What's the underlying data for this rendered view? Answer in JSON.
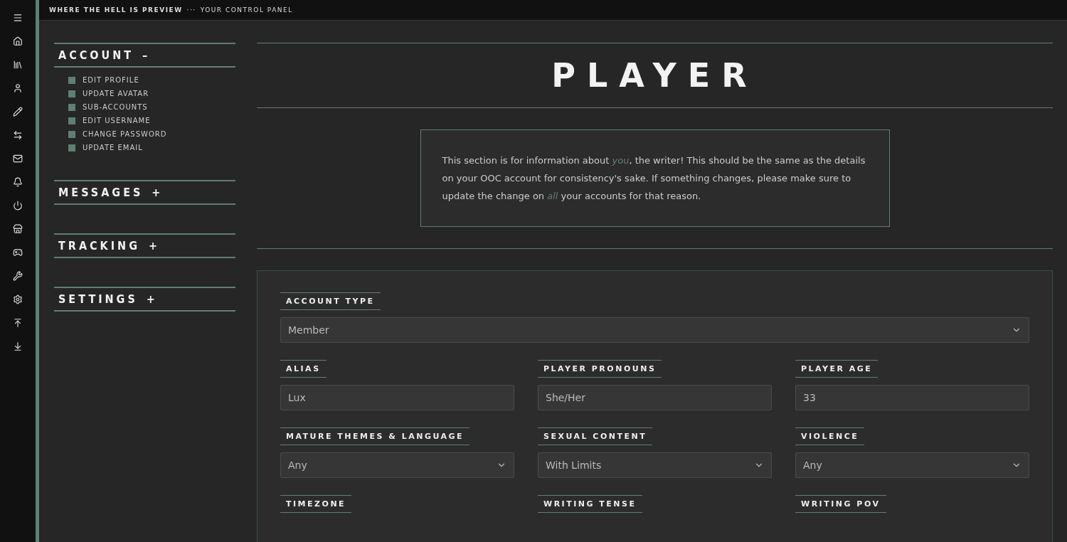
{
  "topbar": {
    "site": "WHERE THE HELL IS PREVIEW",
    "separator": "···",
    "subtitle": "YOUR CONTROL PANEL"
  },
  "sidebar": {
    "sections": [
      {
        "title": "ACCOUNT",
        "toggle": "–",
        "items": [
          "EDIT PROFILE",
          "UPDATE AVATAR",
          "SUB-ACCOUNTS",
          "EDIT USERNAME",
          "CHANGE PASSWORD",
          "UPDATE EMAIL"
        ]
      },
      {
        "title": "MESSAGES",
        "toggle": "+"
      },
      {
        "title": "TRACKING",
        "toggle": "+"
      },
      {
        "title": "SETTINGS",
        "toggle": "+"
      }
    ]
  },
  "page": {
    "title": "PLAYER",
    "intro": "This section is for information about *you*, the writer! This should be the same as the details on your OOC account for consistency's sake. If something changes, please make sure to update the change on *all* your accounts for that reason.",
    "form_rows": [
      [
        {
          "label": "ACCOUNT TYPE",
          "kind": "select",
          "value": "Member"
        }
      ],
      [
        {
          "label": "ALIAS",
          "kind": "text",
          "value": "Lux"
        },
        {
          "label": "PLAYER PRONOUNS",
          "kind": "text",
          "value": "She/Her"
        },
        {
          "label": "PLAYER AGE",
          "kind": "text",
          "value": "33"
        }
      ],
      [
        {
          "label": "MATURE THEMES & LANGUAGE",
          "kind": "select",
          "value": "Any"
        },
        {
          "label": "SEXUAL CONTENT",
          "kind": "select",
          "value": "With Limits"
        },
        {
          "label": "VIOLENCE",
          "kind": "select",
          "value": "Any"
        }
      ],
      [
        {
          "label": "TIMEZONE",
          "kind": "label"
        },
        {
          "label": "WRITING TENSE",
          "kind": "label"
        },
        {
          "label": "WRITING POV",
          "kind": "label"
        }
      ]
    ]
  }
}
